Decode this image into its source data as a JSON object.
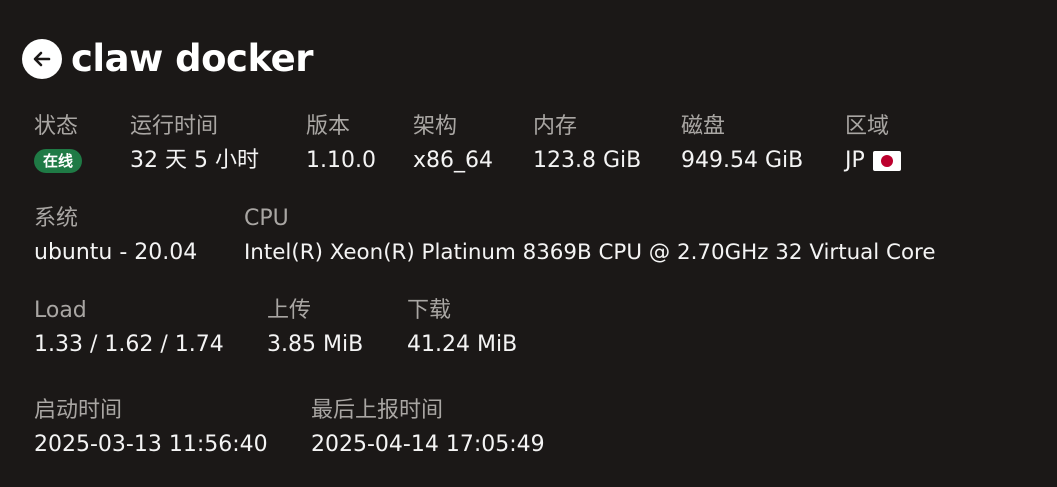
{
  "header": {
    "title": "claw docker",
    "back_icon": "arrow-left-icon"
  },
  "row1": {
    "status": {
      "label": "状态",
      "badge": "在线",
      "badge_color": "#1f7a45"
    },
    "uptime": {
      "label": "运行时间",
      "value": "32 天 5 小时"
    },
    "version": {
      "label": "版本",
      "value": "1.10.0"
    },
    "arch": {
      "label": "架构",
      "value": "x86_64"
    },
    "memory": {
      "label": "内存",
      "value": "123.8 GiB"
    },
    "disk": {
      "label": "磁盘",
      "value": "949.54 GiB"
    },
    "region": {
      "label": "区域",
      "value": "JP",
      "flag_icon": "japan-flag-icon"
    }
  },
  "row2": {
    "system": {
      "label": "系统",
      "value": "ubuntu - 20.04"
    },
    "cpu": {
      "label": "CPU",
      "value": "Intel(R) Xeon(R) Platinum 8369B CPU @ 2.70GHz 32 Virtual Core"
    }
  },
  "row3": {
    "load": {
      "label": "Load",
      "value": "1.33 / 1.62 / 1.74"
    },
    "upload": {
      "label": "上传",
      "value": "3.85 MiB"
    },
    "download": {
      "label": "下载",
      "value": "41.24 MiB"
    }
  },
  "row4": {
    "boot_time": {
      "label": "启动时间",
      "value": "2025-03-13 11:56:40"
    },
    "last_report": {
      "label": "最后上报时间",
      "value": "2025-04-14 17:05:49"
    }
  }
}
